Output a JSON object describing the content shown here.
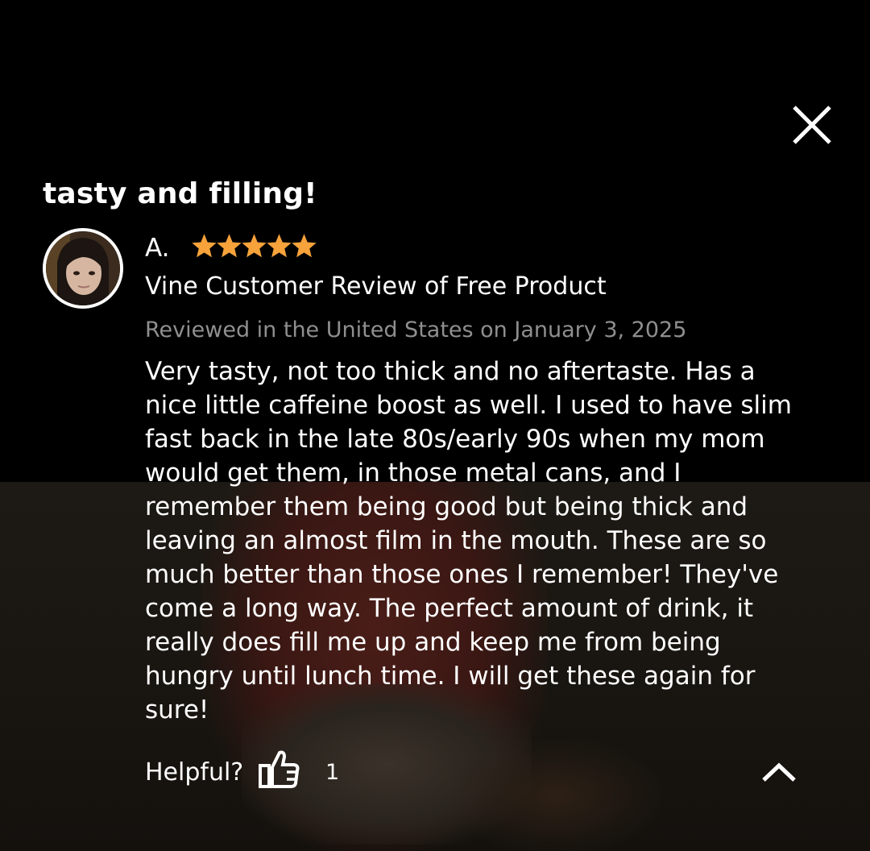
{
  "review": {
    "title": "tasty and filling!",
    "reviewer_name": "A.",
    "rating": 5,
    "rating_max": 5,
    "badge": "Vine Customer Review of Free Product",
    "date_line": "Reviewed in the United States on January 3, 2025",
    "body": "Very tasty, not too thick and no aftertaste. Has a nice little caffeine boost as well. I used to have slim fast back in the late 80s/early 90s when my mom would get them, in those metal cans, and I remember them being good but being thick and leaving an almost film in the mouth. These are so much better than those ones I remember! They've come a long way. The perfect amount of drink, it really does fill me up and keep me from being hungry until lunch time. I will get these again for sure!"
  },
  "footer": {
    "helpful_label": "Helpful?",
    "helpful_count": "1"
  },
  "icons": {
    "close": "close-icon",
    "thumbs_up": "thumbs-up-icon",
    "collapse": "chevron-up-icon",
    "star": "star-icon",
    "avatar": "avatar"
  },
  "colors": {
    "background": "#000000",
    "text": "#ffffff",
    "muted_text": "#8f8f8f",
    "star": "#f7a23b"
  }
}
